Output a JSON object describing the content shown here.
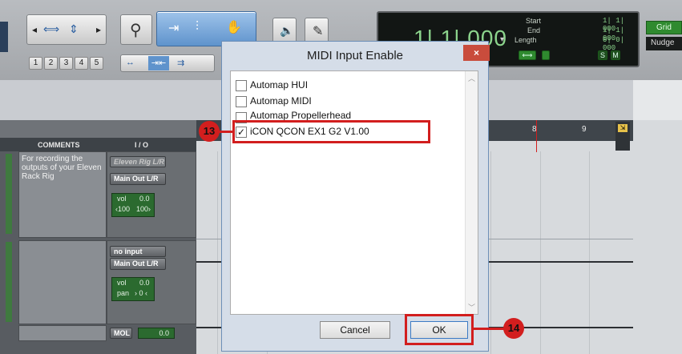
{
  "toolbar": {
    "track_numbers": [
      "1",
      "2",
      "3",
      "4",
      "5"
    ],
    "counter": {
      "main": "1| 1| 000",
      "start_label": "Start",
      "end_label": "End",
      "length_label": "Length",
      "start_value": "1| 1| 000",
      "end_value": "1| 1| 000",
      "length_value": "0| 0| 000"
    },
    "grid_label": "Grid",
    "nudge_label": "Nudge"
  },
  "columns": {
    "comments": "COMMENTS",
    "io": "I / O"
  },
  "ruler": {
    "bar8": "8",
    "bar9": "9"
  },
  "tracks": [
    {
      "comment": "For recording the outputs of your Eleven Rack Rig",
      "input": "Eleven Rig L/R",
      "output": "Main Out L/R",
      "vol_label": "vol",
      "vol_value": "0.0",
      "pan_left": "‹100",
      "pan_right": "100›"
    },
    {
      "comment": "",
      "input": "no input",
      "output": "Main Out L/R",
      "vol_label": "vol",
      "vol_value": "0.0",
      "pan_label": "pan",
      "pan_value": "› 0 ‹"
    },
    {
      "output": "MOL",
      "vol_value": "0.0"
    }
  ],
  "dialog": {
    "title": "MIDI Input Enable",
    "close_label": "×",
    "items": [
      {
        "label": "Automap HUI",
        "checked": false
      },
      {
        "label": "Automap MIDI",
        "checked": false
      },
      {
        "label": "Automap Propellerhead",
        "checked": false
      },
      {
        "label": "iCON QCON EX1 G2 V1.00",
        "checked": true
      }
    ],
    "cancel_label": "Cancel",
    "ok_label": "OK"
  },
  "callouts": {
    "step13": "13",
    "step14": "14"
  },
  "colors": {
    "callout": "#d21e1e",
    "counter_text": "#8cd48c",
    "selected_tool": "#5f93cc"
  }
}
